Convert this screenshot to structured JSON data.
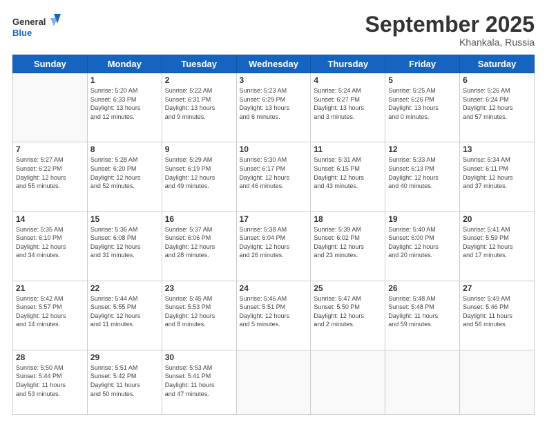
{
  "header": {
    "logo_line1": "General",
    "logo_line2": "Blue",
    "month": "September 2025",
    "location": "Khankala, Russia"
  },
  "weekdays": [
    "Sunday",
    "Monday",
    "Tuesday",
    "Wednesday",
    "Thursday",
    "Friday",
    "Saturday"
  ],
  "weeks": [
    [
      {
        "day": "",
        "info": ""
      },
      {
        "day": "1",
        "info": "Sunrise: 5:20 AM\nSunset: 6:33 PM\nDaylight: 13 hours\nand 12 minutes."
      },
      {
        "day": "2",
        "info": "Sunrise: 5:22 AM\nSunset: 6:31 PM\nDaylight: 13 hours\nand 9 minutes."
      },
      {
        "day": "3",
        "info": "Sunrise: 5:23 AM\nSunset: 6:29 PM\nDaylight: 13 hours\nand 6 minutes."
      },
      {
        "day": "4",
        "info": "Sunrise: 5:24 AM\nSunset: 6:27 PM\nDaylight: 13 hours\nand 3 minutes."
      },
      {
        "day": "5",
        "info": "Sunrise: 5:25 AM\nSunset: 6:26 PM\nDaylight: 13 hours\nand 0 minutes."
      },
      {
        "day": "6",
        "info": "Sunrise: 5:26 AM\nSunset: 6:24 PM\nDaylight: 12 hours\nand 57 minutes."
      }
    ],
    [
      {
        "day": "7",
        "info": "Sunrise: 5:27 AM\nSunset: 6:22 PM\nDaylight: 12 hours\nand 55 minutes."
      },
      {
        "day": "8",
        "info": "Sunrise: 5:28 AM\nSunset: 6:20 PM\nDaylight: 12 hours\nand 52 minutes."
      },
      {
        "day": "9",
        "info": "Sunrise: 5:29 AM\nSunset: 6:19 PM\nDaylight: 12 hours\nand 49 minutes."
      },
      {
        "day": "10",
        "info": "Sunrise: 5:30 AM\nSunset: 6:17 PM\nDaylight: 12 hours\nand 46 minutes."
      },
      {
        "day": "11",
        "info": "Sunrise: 5:31 AM\nSunset: 6:15 PM\nDaylight: 12 hours\nand 43 minutes."
      },
      {
        "day": "12",
        "info": "Sunrise: 5:33 AM\nSunset: 6:13 PM\nDaylight: 12 hours\nand 40 minutes."
      },
      {
        "day": "13",
        "info": "Sunrise: 5:34 AM\nSunset: 6:11 PM\nDaylight: 12 hours\nand 37 minutes."
      }
    ],
    [
      {
        "day": "14",
        "info": "Sunrise: 5:35 AM\nSunset: 6:10 PM\nDaylight: 12 hours\nand 34 minutes."
      },
      {
        "day": "15",
        "info": "Sunrise: 5:36 AM\nSunset: 6:08 PM\nDaylight: 12 hours\nand 31 minutes."
      },
      {
        "day": "16",
        "info": "Sunrise: 5:37 AM\nSunset: 6:06 PM\nDaylight: 12 hours\nand 28 minutes."
      },
      {
        "day": "17",
        "info": "Sunrise: 5:38 AM\nSunset: 6:04 PM\nDaylight: 12 hours\nand 26 minutes."
      },
      {
        "day": "18",
        "info": "Sunrise: 5:39 AM\nSunset: 6:02 PM\nDaylight: 12 hours\nand 23 minutes."
      },
      {
        "day": "19",
        "info": "Sunrise: 5:40 AM\nSunset: 6:00 PM\nDaylight: 12 hours\nand 20 minutes."
      },
      {
        "day": "20",
        "info": "Sunrise: 5:41 AM\nSunset: 5:59 PM\nDaylight: 12 hours\nand 17 minutes."
      }
    ],
    [
      {
        "day": "21",
        "info": "Sunrise: 5:42 AM\nSunset: 5:57 PM\nDaylight: 12 hours\nand 14 minutes."
      },
      {
        "day": "22",
        "info": "Sunrise: 5:44 AM\nSunset: 5:55 PM\nDaylight: 12 hours\nand 11 minutes."
      },
      {
        "day": "23",
        "info": "Sunrise: 5:45 AM\nSunset: 5:53 PM\nDaylight: 12 hours\nand 8 minutes."
      },
      {
        "day": "24",
        "info": "Sunrise: 5:46 AM\nSunset: 5:51 PM\nDaylight: 12 hours\nand 5 minutes."
      },
      {
        "day": "25",
        "info": "Sunrise: 5:47 AM\nSunset: 5:50 PM\nDaylight: 12 hours\nand 2 minutes."
      },
      {
        "day": "26",
        "info": "Sunrise: 5:48 AM\nSunset: 5:48 PM\nDaylight: 11 hours\nand 59 minutes."
      },
      {
        "day": "27",
        "info": "Sunrise: 5:49 AM\nSunset: 5:46 PM\nDaylight: 11 hours\nand 56 minutes."
      }
    ],
    [
      {
        "day": "28",
        "info": "Sunrise: 5:50 AM\nSunset: 5:44 PM\nDaylight: 11 hours\nand 53 minutes."
      },
      {
        "day": "29",
        "info": "Sunrise: 5:51 AM\nSunset: 5:42 PM\nDaylight: 11 hours\nand 50 minutes."
      },
      {
        "day": "30",
        "info": "Sunrise: 5:53 AM\nSunset: 5:41 PM\nDaylight: 11 hours\nand 47 minutes."
      },
      {
        "day": "",
        "info": ""
      },
      {
        "day": "",
        "info": ""
      },
      {
        "day": "",
        "info": ""
      },
      {
        "day": "",
        "info": ""
      }
    ]
  ]
}
